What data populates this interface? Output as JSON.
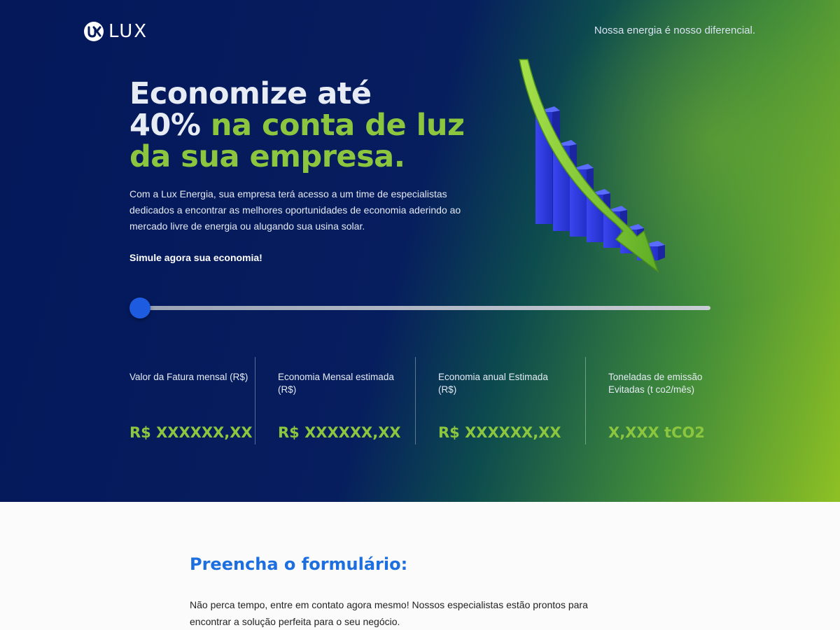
{
  "brand": {
    "name": "LUX",
    "tagline": "Nossa energia é nosso diferencial."
  },
  "hero": {
    "headline_line1": "Economize até",
    "headline_line2_white": "40%",
    "headline_line2_green": " na conta de luz",
    "headline_line3": "da sua empresa.",
    "description": "Com a Lux Energia, sua empresa terá acesso a um time de especialistas dedicados a encontrar as melhores oportunidades de economia aderindo ao mercado livre de energia ou alugando sua usina solar.",
    "cta": "Simule agora sua economia!"
  },
  "slider": {
    "value": 0
  },
  "stats": [
    {
      "label": "Valor da Fatura mensal (R$)",
      "value": "R$ XXXXXX,XX"
    },
    {
      "label": "Economia Mensal estimada (R$)",
      "value": "R$ XXXXXX,XX"
    },
    {
      "label": "Economia anual Estimada (R$)",
      "value": "R$ XXXXXX,XX"
    },
    {
      "label": "Toneladas de emissão Evitadas (t co2/mês)",
      "value": "X,XXX tCO2"
    }
  ],
  "form": {
    "title": "Preencha o formulário:",
    "description": "Não perca tempo, entre em contato agora mesmo! Nossos especialistas estão prontos para encontrar a solução perfeita para o seu negócio."
  },
  "colors": {
    "accent_green": "#8cc63f",
    "accent_blue": "#1d6fe0",
    "navy": "#04185a"
  }
}
